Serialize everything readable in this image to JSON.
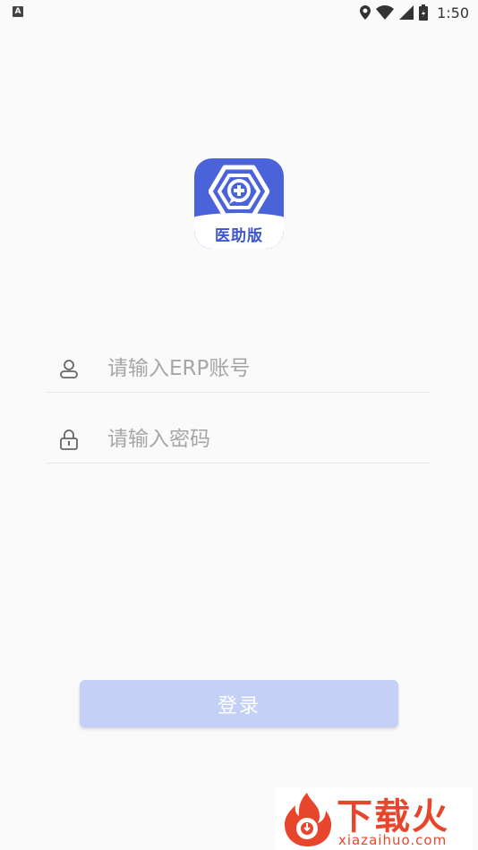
{
  "status_bar": {
    "left_badge": "A",
    "time": "1:50",
    "icons": [
      "location-icon",
      "wifi-icon",
      "signal-icon",
      "battery-icon"
    ]
  },
  "logo": {
    "brand_text": "医助版",
    "icon": "medical-hexagon-icon"
  },
  "form": {
    "username": {
      "placeholder": "请输入ERP账号",
      "value": "",
      "icon": "user-icon"
    },
    "password": {
      "placeholder": "请输入密码",
      "value": "",
      "icon": "lock-icon"
    }
  },
  "login_button": {
    "label": "登录"
  },
  "watermark": {
    "brand_zh": "下载火",
    "domain": "xiazaihuo.com"
  },
  "colors": {
    "accent": "#4b63d9",
    "button_disabled": "#c5d0f7",
    "watermark": "#e8462c"
  }
}
